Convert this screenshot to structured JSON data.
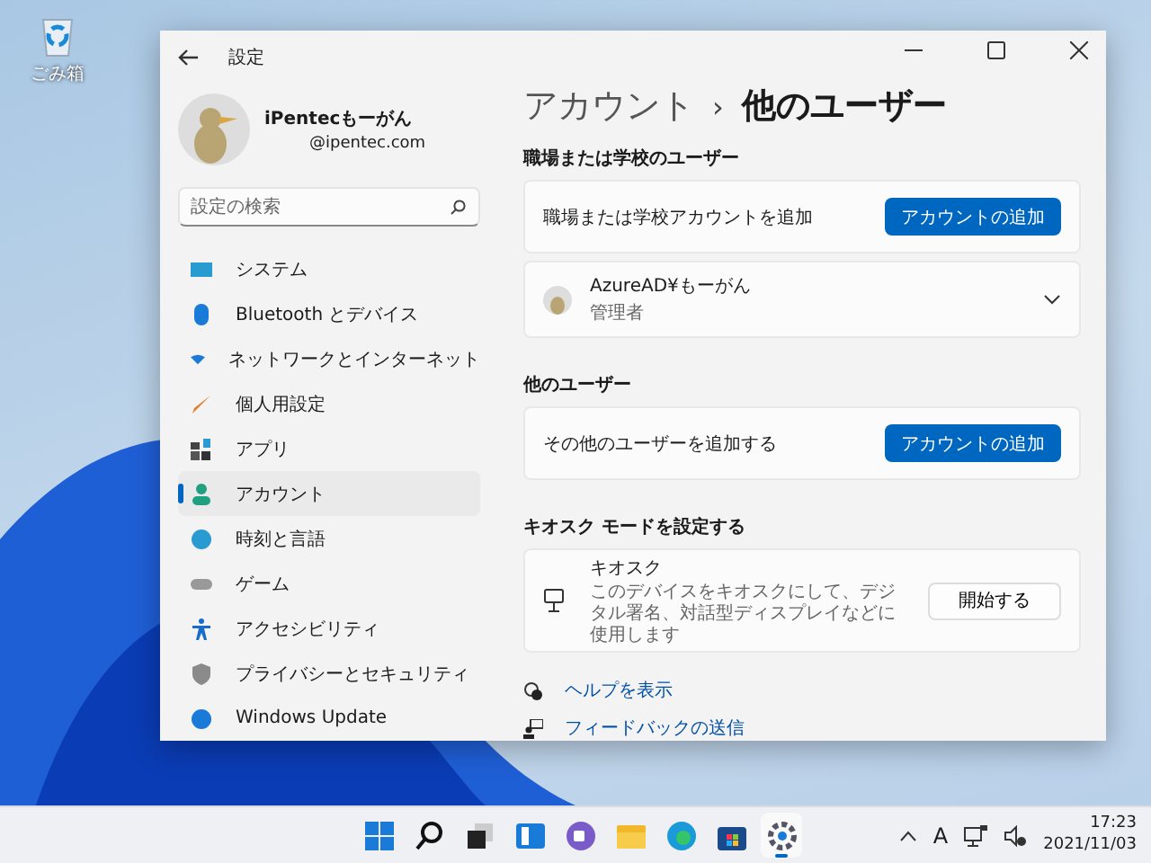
{
  "desktop": {
    "icons": [
      {
        "label": "ごみ箱"
      }
    ]
  },
  "window": {
    "title": "設定"
  },
  "profile": {
    "name": "iPentecもーがん",
    "email": "@ipentec.com"
  },
  "search": {
    "placeholder": "設定の検索"
  },
  "nav": [
    {
      "label": "システム",
      "selected": false
    },
    {
      "label": "Bluetooth とデバイス",
      "selected": false
    },
    {
      "label": "ネットワークとインターネット",
      "selected": false
    },
    {
      "label": "個人用設定",
      "selected": false
    },
    {
      "label": "アプリ",
      "selected": false
    },
    {
      "label": "アカウント",
      "selected": true
    },
    {
      "label": "時刻と言語",
      "selected": false
    },
    {
      "label": "ゲーム",
      "selected": false
    },
    {
      "label": "アクセシビリティ",
      "selected": false
    },
    {
      "label": "プライバシーとセキュリティ",
      "selected": false
    },
    {
      "label": "Windows Update",
      "selected": false
    }
  ],
  "breadcrumb": {
    "parent": "アカウント",
    "separator": "›",
    "current": "他のユーザー"
  },
  "work_section": {
    "heading": "職場または学校のユーザー",
    "add_row": {
      "label": "職場または学校アカウントを追加",
      "button": "アカウントの追加"
    },
    "user": {
      "name": "AzureAD¥もーがん",
      "role": "管理者",
      "expanded": false
    }
  },
  "other_section": {
    "heading": "他のユーザー",
    "add_row": {
      "label": "その他のユーザーを追加する",
      "button": "アカウントの追加"
    }
  },
  "kiosk_section": {
    "heading": "キオスク モードを設定する",
    "title": "キオスク",
    "description": "このデバイスをキオスクにして、デジタル署名、対話型ディスプレイなどに使用します",
    "button": "開始する"
  },
  "links": [
    {
      "label": "ヘルプを表示"
    },
    {
      "label": "フィードバックの送信"
    }
  ],
  "taskbar": {
    "apps": [
      {
        "selected": false
      },
      {
        "selected": false
      },
      {
        "selected": false
      },
      {
        "selected": false
      },
      {
        "selected": false
      },
      {
        "selected": false
      },
      {
        "selected": false
      },
      {
        "selected": false
      },
      {
        "selected": true
      }
    ],
    "ime": "A",
    "time": "17:23",
    "date": "2021/11/03"
  }
}
